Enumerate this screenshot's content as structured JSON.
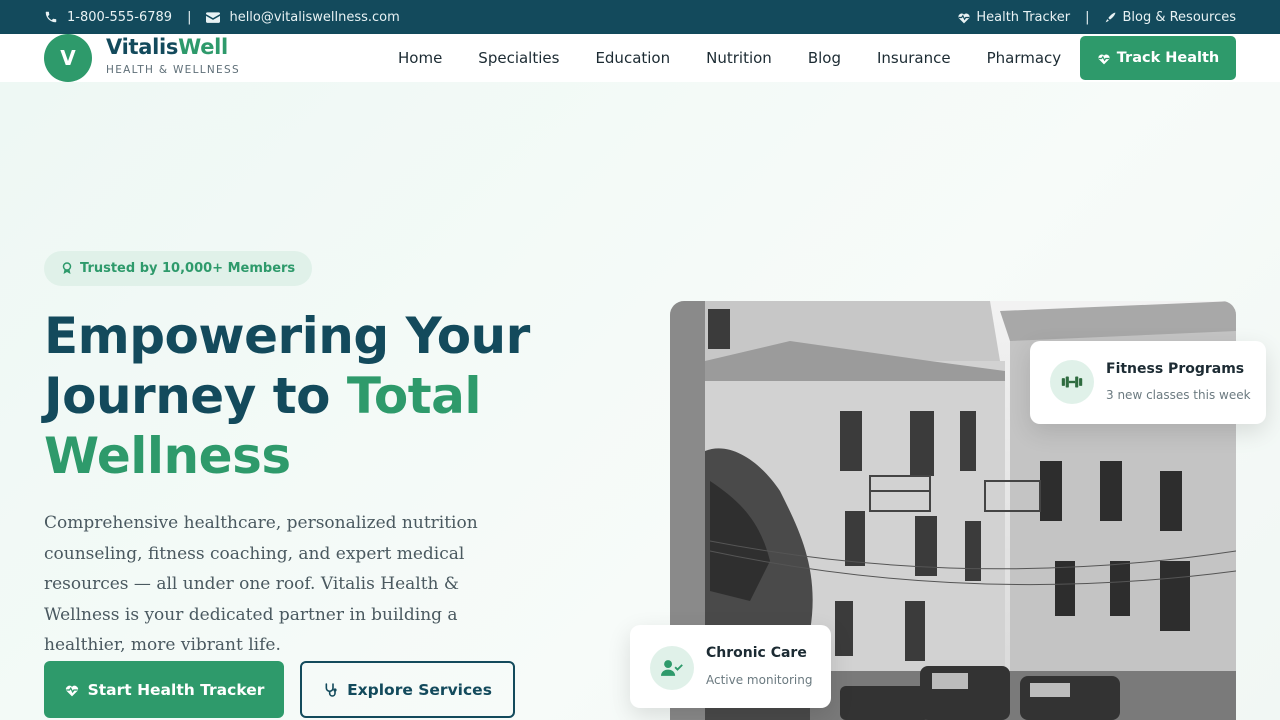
{
  "topbar": {
    "phone": "1-800-555-6789",
    "separator": "|",
    "email": "hello@vitaliswellness.com",
    "links": [
      "Health Tracker",
      "Blog & Resources"
    ]
  },
  "logo": {
    "letter": "V",
    "name_part1": "Vitalis",
    "name_part2": "Well",
    "tagline": "HEALTH & WELLNESS"
  },
  "nav": {
    "items": [
      "Home",
      "Specialties",
      "Education",
      "Nutrition",
      "Blog",
      "Insurance",
      "Pharmacy"
    ],
    "cta": "Track Health"
  },
  "hero": {
    "badge": "Trusted by 10,000+ Members",
    "headline_part1": "Empowering Your",
    "headline_part2": "Journey to ",
    "headline_highlight1": "Total",
    "headline_highlight2": "Wellness",
    "description": "Comprehensive healthcare, personalized nutrition counseling, fitness coaching, and expert medical resources — all under one roof. Vitalis Health & Wellness is your dedicated partner in building a healthier, more vibrant life.",
    "primary_button": "Start Health Tracker",
    "secondary_button": "Explore Services"
  },
  "cards": {
    "fitness": {
      "title": "Fitness Programs",
      "subtitle": "3 new classes this week"
    },
    "chronic": {
      "title": "Chronic Care",
      "subtitle": "Active monitoring"
    }
  },
  "colors": {
    "brand_green": "#2e9a6b",
    "brand_navy": "#134a5c"
  },
  "icons": [
    "phone-icon",
    "envelope-icon",
    "heartbeat-icon",
    "pen-icon",
    "award-icon",
    "stethoscope-icon",
    "dumbbell-icon",
    "user-check-icon"
  ]
}
